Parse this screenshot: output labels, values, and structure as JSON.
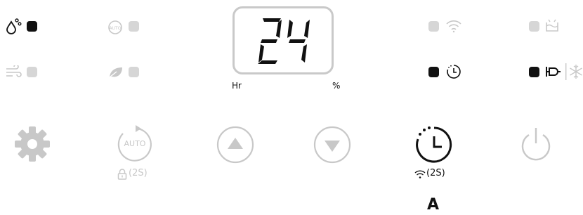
{
  "display": {
    "value": "24",
    "left_label": "Hr",
    "right_label": "%"
  },
  "buttons": {
    "auto": {
      "label": "AUTO",
      "sub": "(2S)"
    },
    "timer": {
      "sub": "(2S)",
      "callout": "A"
    }
  },
  "colors": {
    "active": "#111111",
    "inactive": "#d6d6d6",
    "icon_gray": "#c8c8c8"
  }
}
